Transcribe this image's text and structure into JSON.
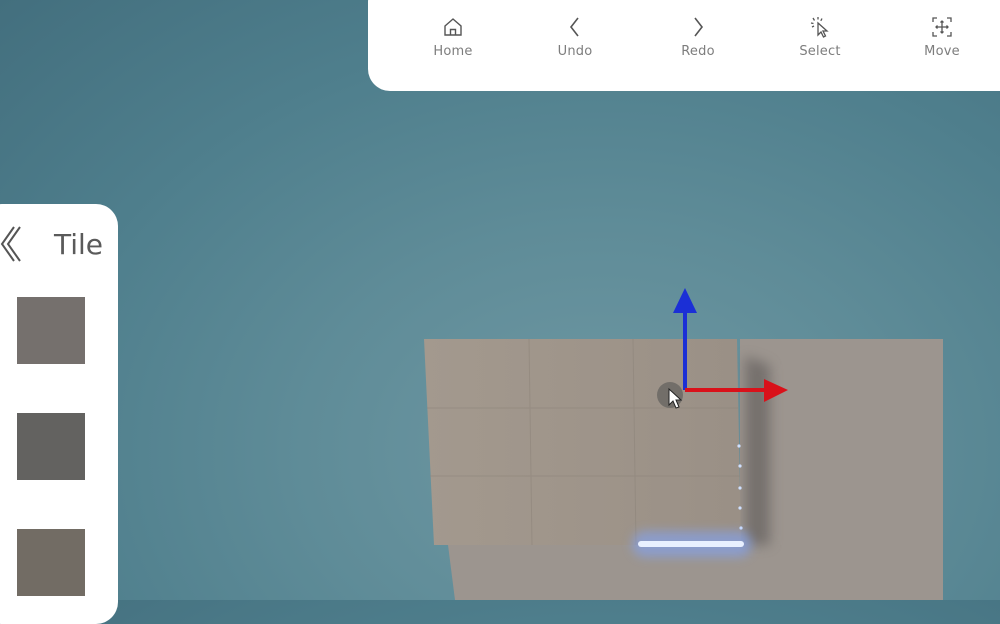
{
  "toolbar": {
    "items": [
      {
        "label": "Home",
        "icon": "home-icon"
      },
      {
        "label": "Undo",
        "icon": "chevron-left-icon"
      },
      {
        "label": "Redo",
        "icon": "chevron-right-icon"
      },
      {
        "label": "Select",
        "icon": "select-pointer-icon"
      },
      {
        "label": "Move",
        "icon": "move-icon"
      }
    ]
  },
  "panel": {
    "title": "Tile",
    "back_icon": "double-chevron-left-icon",
    "swatches": [
      {
        "name": "tile-swatch-1",
        "color": "#75706d"
      },
      {
        "name": "tile-swatch-2",
        "color": "#636260"
      },
      {
        "name": "tile-swatch-3",
        "color": "#726c64"
      }
    ]
  },
  "gizmo": {
    "x_axis_color": "#d9111a",
    "y_axis_color": "#1b2fd6"
  },
  "colors": {
    "sky_top": "#436f7e",
    "sky_mid": "#5f8c98",
    "floor": "#9b958f",
    "wall": "#a1978c",
    "highlight": "#9fc0ff"
  }
}
